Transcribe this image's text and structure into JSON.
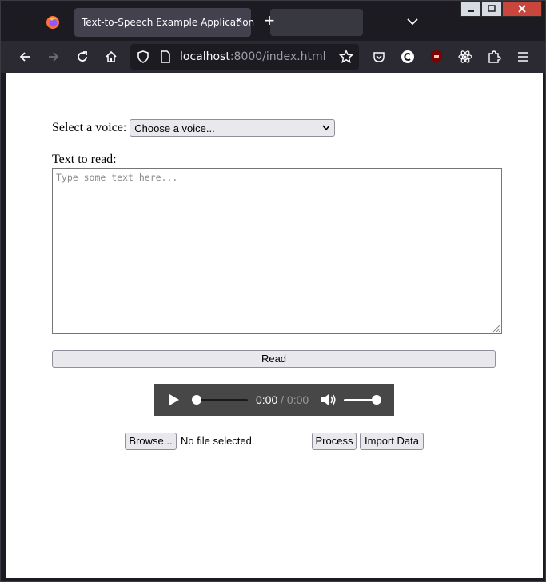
{
  "browser": {
    "tab_title": "Text-to-Speech Example Application",
    "tab_close_glyph": "×",
    "new_tab_glyph": "+",
    "url_host": "localhost",
    "url_path": ":8000/index.html",
    "icons": {
      "logo": "firefox-icon",
      "back": "back-arrow-icon",
      "forward": "forward-arrow-icon",
      "reload": "reload-icon",
      "home": "home-icon",
      "shield": "shield-icon",
      "page": "page-icon",
      "bookmark": "star-icon",
      "pocket": "pocket-icon",
      "ext1": "c-extension-icon",
      "ext2": "ublock-icon",
      "ext3": "react-devtools-icon",
      "extensions": "puzzle-icon",
      "menu": "hamburger-menu-icon"
    }
  },
  "form": {
    "voice_label": "Select a voice:",
    "voice_selected": "Choose a voice...",
    "text_label": "Text to read:",
    "text_placeholder": "Type some text here...",
    "read_button": "Read"
  },
  "audio": {
    "current_time": "0:00",
    "separator": " / ",
    "duration": "0:00",
    "progress": 0,
    "volume": 1.0
  },
  "files": {
    "browse_button": "Browse...",
    "file_status": "No file selected.",
    "process_button": "Process",
    "import_button": "Import Data"
  },
  "colors": {
    "chrome_dark": "#1c1b22",
    "toolbar": "#2b2a33",
    "tab_active": "#42414d",
    "button_bg": "#e9e9ed",
    "audio_bg": "#474747",
    "ublock_red": "#800000"
  }
}
